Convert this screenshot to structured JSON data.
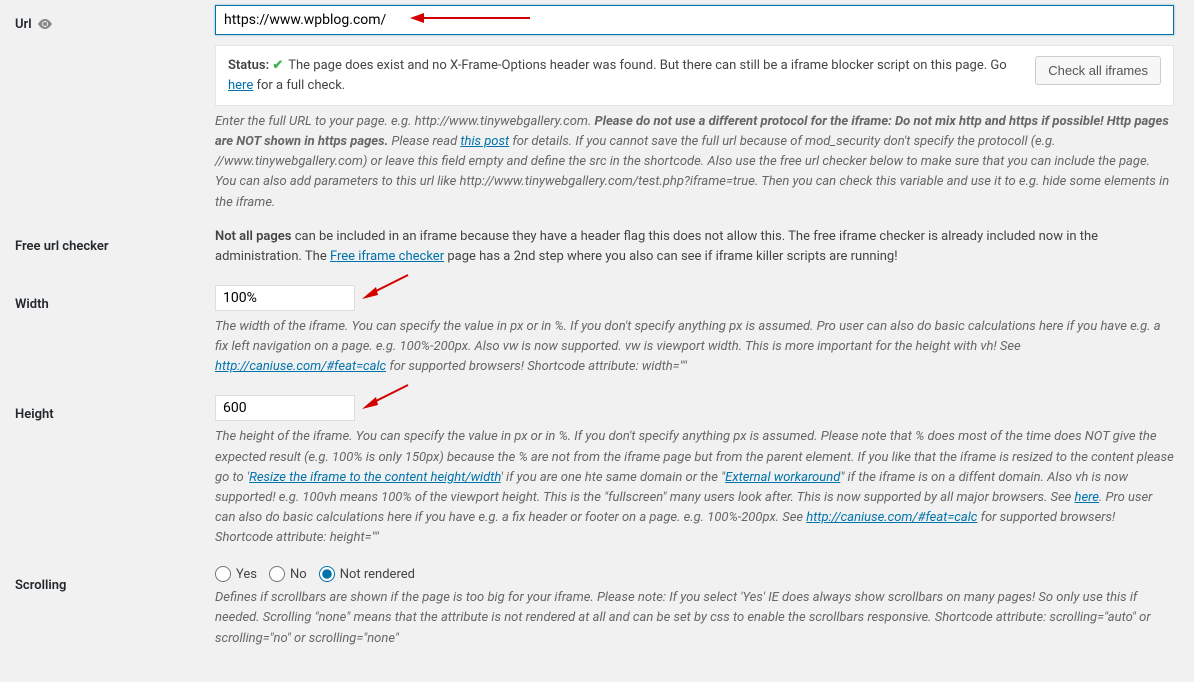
{
  "url": {
    "label": "Url",
    "value": "https://www.wpblog.com/",
    "status_label": "Status:",
    "status_text_1": "The page does exist and no X-Frame-Options header was found. But there can still be a iframe blocker script on this page. Go ",
    "status_link": "here",
    "status_text_2": " for a full check.",
    "check_button": "Check all iframes",
    "desc_1": "Enter the full URL to your page. e.g. http://www.tinywebgallery.com. ",
    "desc_bold": "Please do not use a different protocol for the iframe: Do not mix http and https if possible! Http pages are NOT shown in https pages.",
    "desc_2": " Please read ",
    "desc_link": "this post",
    "desc_3": " for details. If you cannot save the full url because of mod_security don't specify the protocoll (e.g. //www.tinywebgallery.com) or leave this field empty and define the src in the shortcode. Also use the free url checker below to make sure that you can include the page. You can also add parameters to this url like http://www.tinywebgallery.com/test.php?iframe=true. Then you can check this variable and use it to e.g. hide some elements in the iframe."
  },
  "free_url_checker": {
    "label": "Free url checker",
    "text_bold": "Not all pages",
    "text_1": " can be included in an iframe because they have a header flag this does not allow this. The free iframe checker is already included now in the administration. The ",
    "link": "Free iframe checker",
    "text_2": " page has a 2nd step where you also can see if iframe killer scripts are running!"
  },
  "width": {
    "label": "Width",
    "value": "100%",
    "desc_1": "The width of the iframe. You can specify the value in px or in %. If you don't specify anything px is assumed. Pro user can also do basic calculations here if you have e.g. a fix left navigation on a page. e.g. 100%-200px. Also vw is now supported. vw is viewport width. This is more important for the height with vh! See ",
    "link": "http://caniuse.com/#feat=calc",
    "desc_2": " for supported browsers! Shortcode attribute: width=\"\""
  },
  "height": {
    "label": "Height",
    "value": "600",
    "desc_1": "The height of the iframe. You can specify the value in px or in %. If you don't specify anything px is assumed. Please note that % does most of the time does NOT give the expected result (e.g. 100% is only 150px) because the % are not from the iframe page but from the parent element. If you like that the iframe is resized to the content please go to '",
    "link1": "Resize the iframe to the content height/width",
    "desc_2": "' if you are one hte same domain or the \"",
    "link2": "External workaround",
    "desc_3": "\" if the iframe is on a diffent domain. Also vh is now supported! e.g. 100vh means 100% of the viewport height. This is the \"fullscreen\" many users look after. This is now supported by all major browsers. See ",
    "link3": "here",
    "desc_4": ". Pro user can also do basic calculations here if you have e.g. a fix header or footer on a page. e.g. 100%-200px. See ",
    "link4": "http://caniuse.com/#feat=calc",
    "desc_5": " for supported browsers! Shortcode attribute: height=\"\""
  },
  "scrolling": {
    "label": "Scrolling",
    "yes": "Yes",
    "no": "No",
    "not_rendered": "Not rendered",
    "desc": "Defines if scrollbars are shown if the page is too big for your iframe. Please note: If you select 'Yes' IE does always show scrollbars on many pages! So only use this if needed. Scrolling \"none\" means that the attribute is not rendered at all and can be set by css to enable the scrollbars responsive. Shortcode attribute: scrolling=\"auto\" or scrolling=\"no\" or scrolling=\"none\""
  }
}
